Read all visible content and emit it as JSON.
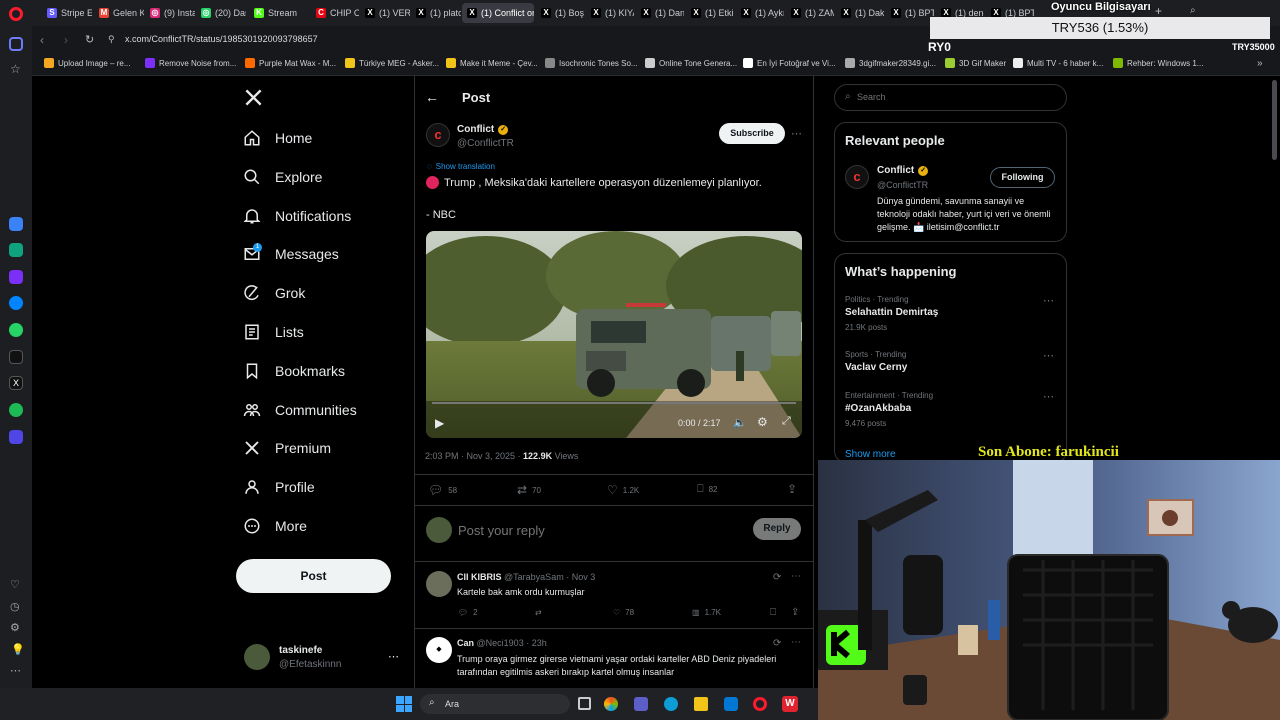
{
  "browser": {
    "tabs": [
      {
        "label": "Stripe Ex",
        "color": "#635bff",
        "glyph": "S"
      },
      {
        "label": "Gelen Ku",
        "color": "#ea4335",
        "glyph": "M"
      },
      {
        "label": "(9) Insta",
        "color": "#d62976",
        "glyph": "◎"
      },
      {
        "label": "(20) Das",
        "color": "#25d366",
        "glyph": "◎"
      },
      {
        "label": "Stream",
        "color": "#53fc18",
        "glyph": "K"
      },
      {
        "label": "CHIP On",
        "color": "#e30613",
        "glyph": "C"
      },
      {
        "label": "(1) VERG",
        "color": "#000000",
        "glyph": "X"
      },
      {
        "label": "(1) plato",
        "color": "#000000",
        "glyph": "X"
      },
      {
        "label": "(1) Conflict on",
        "color": "#000000",
        "glyph": "X"
      },
      {
        "label": "(1) Boşu",
        "color": "#000000",
        "glyph": "X"
      },
      {
        "label": "(1) KIYA",
        "color": "#000000",
        "glyph": "X"
      },
      {
        "label": "(1) Danış",
        "color": "#000000",
        "glyph": "X"
      },
      {
        "label": "(1) Etkili",
        "color": "#000000",
        "glyph": "X"
      },
      {
        "label": "(1) Aykır",
        "color": "#000000",
        "glyph": "X"
      },
      {
        "label": "(1) ZAM",
        "color": "#000000",
        "glyph": "X"
      },
      {
        "label": "(1) Dakti",
        "color": "#000000",
        "glyph": "X"
      },
      {
        "label": "(1) BPT",
        "color": "#000000",
        "glyph": "X"
      },
      {
        "label": "(1) deno",
        "color": "#000000",
        "glyph": "X"
      },
      {
        "label": "(1) BPT",
        "color": "#000000",
        "glyph": "X"
      }
    ],
    "url": "x.com/ConflictTR/status/1985301920093798657",
    "bookmarks": [
      {
        "label": "Upload Image – re...",
        "color": "#f5a623"
      },
      {
        "label": "Remove Noise from...",
        "color": "#7b2ff7"
      },
      {
        "label": "Purple Mat Wax - M...",
        "color": "#ff6a00"
      },
      {
        "label": "Türkiye MEG - Asker...",
        "color": "#f0c419"
      },
      {
        "label": "Make it Meme - Çev...",
        "color": "#f0c419"
      },
      {
        "label": "Isochronic Tones So...",
        "color": "#888888"
      },
      {
        "label": "Online Tone Genera...",
        "color": "#cccccc"
      },
      {
        "label": "En İyi Fotoğraf ve Vi...",
        "color": "#ffffff"
      },
      {
        "label": "3dgifmaker28349.gi...",
        "color": "#aaaaaa"
      },
      {
        "label": "3D Gif Maker",
        "color": "#9acd32"
      },
      {
        "label": "Multi TV - 6 haber k...",
        "color": "#eeeeee"
      },
      {
        "label": "Rehber: Windows 1...",
        "color": "#7fba00"
      }
    ]
  },
  "overlay": {
    "top_text": "Oyuncu Bilgisayarı",
    "ticker": "TRY536 (1.53%)",
    "left_code": "RY0",
    "right_code": "TRY35000",
    "subscriber": "Son Abone: farukincii"
  },
  "nav": {
    "items": [
      {
        "label": "Home",
        "icon": "home-icon"
      },
      {
        "label": "Explore",
        "icon": "search-icon"
      },
      {
        "label": "Notifications",
        "icon": "bell-icon"
      },
      {
        "label": "Messages",
        "icon": "mail-icon"
      },
      {
        "label": "Grok",
        "icon": "grok-icon"
      },
      {
        "label": "Lists",
        "icon": "list-icon"
      },
      {
        "label": "Bookmarks",
        "icon": "bookmark-icon"
      },
      {
        "label": "Communities",
        "icon": "people-icon"
      },
      {
        "label": "Premium",
        "icon": "x-icon"
      },
      {
        "label": "Profile",
        "icon": "person-icon"
      },
      {
        "label": "More",
        "icon": "more-icon"
      }
    ],
    "messages_badge": "1",
    "post_button": "Post",
    "user": {
      "name": "taskinefe",
      "handle": "@Efetaskinnn"
    }
  },
  "post": {
    "header": "Post",
    "author": "Conflict",
    "handle": "@ConflictTR",
    "subscribe": "Subscribe",
    "show_translation": "Show translation",
    "text": "Trump , Meksika'daki kartellere operasyon düzenlemeyi planlıyor.",
    "source": "- NBC",
    "video_time": "0:00 / 2:17",
    "timestamp": "2:03 PM · Nov 3, 2025 · ",
    "views_count": "122.9K",
    "views_label": " Views",
    "replies": "58",
    "reposts": "70",
    "likes": "1.2K",
    "bookmarks": "82",
    "reply_placeholder": "Post your reply",
    "reply_button": "Reply"
  },
  "replies": [
    {
      "name": "Cll KIBRIS",
      "handle": "@TarabyaSam · Nov 3",
      "text": "Kartele bak amk ordu kurmuşlar",
      "replies": "2",
      "likes": "78",
      "views": "1.7K"
    },
    {
      "name": "Can",
      "handle": "@Neci1903 · 23h",
      "text": "Trump oraya girmez girerse vietnami yaşar ordaki karteller ABD Deniz piyadeleri tarafından egitilmis askeri bırakıp kartel olmuş insanlar"
    }
  ],
  "sidebar": {
    "search_placeholder": "Search",
    "relevant_title": "Relevant people",
    "person": {
      "name": "Conflict",
      "handle": "@ConflictTR",
      "follow_label": "Following",
      "bio": "Dünya gündemi, savunma sanayii ve teknoloji odaklı haber, yurt içi veri ve önemli gelişme. 📩 iletisim@conflict.tr"
    },
    "happening_title": "What’s happening",
    "trends": [
      {
        "meta": "Politics · Trending",
        "name": "Selahattin Demirtaş",
        "posts": "21.9K posts"
      },
      {
        "meta": "Sports · Trending",
        "name": "Vaclav Cerny",
        "posts": ""
      },
      {
        "meta": "Entertainment · Trending",
        "name": "#OzanAkbaba",
        "posts": "9,476 posts"
      }
    ],
    "show_more": "Show more"
  },
  "taskbar": {
    "search_label": "Ara"
  }
}
